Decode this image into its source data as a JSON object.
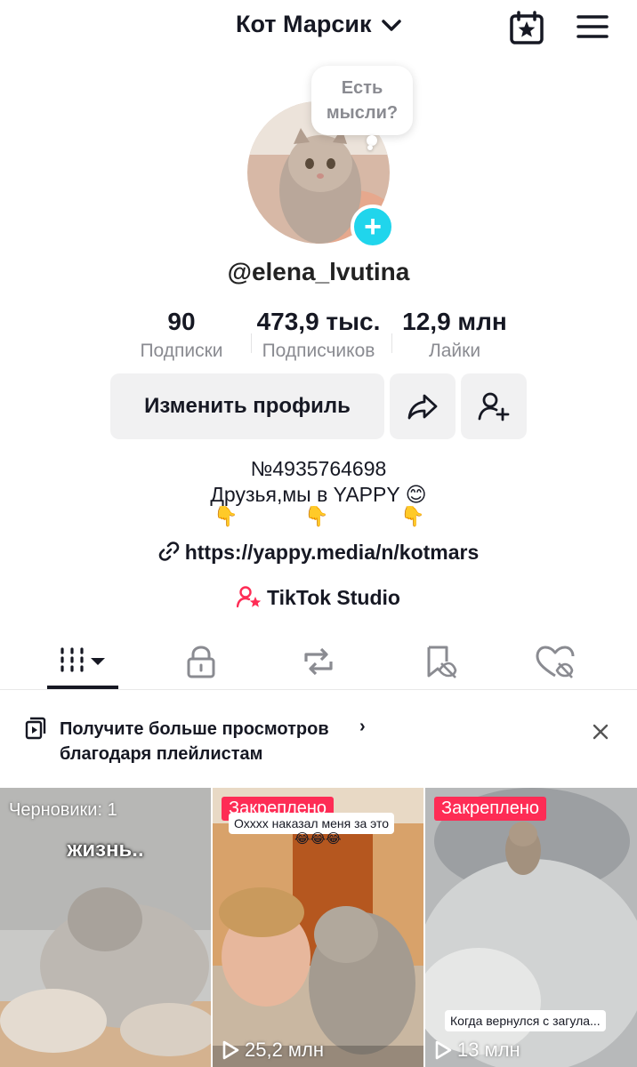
{
  "header": {
    "account_name": "Кот Марсик"
  },
  "profile": {
    "thought_bubble": "Есть мысли?",
    "username": "@elena_lvutina",
    "stats": [
      {
        "value": "90",
        "label": "Подписки"
      },
      {
        "value": "473,9 тыс.",
        "label": "Подписчиков"
      },
      {
        "value": "12,9 млн",
        "label": "Лайки"
      }
    ],
    "edit_button": "Изменить профиль",
    "bio_line1": "№4935764698",
    "bio_line2": "Друзья,мы в YAPPY 😊",
    "pointer_emoji": "👇",
    "link": "https://yappy.media/n/kotmars",
    "studio": "TikTok Studio"
  },
  "promo": {
    "line1": "Получите больше просмотров",
    "line2": "благодаря плейлистам",
    "arrow": "›"
  },
  "videos": [
    {
      "label": "Черновики: 1",
      "overlay": "жизнь.."
    },
    {
      "badge": "Закреплено",
      "caption": "Охххх наказал меня за это",
      "emoji": "😂😂😂",
      "views": "25,2 млн"
    },
    {
      "badge": "Закреплено",
      "caption": "Когда вернулся с загула...",
      "views": "13 млн"
    }
  ],
  "colors": {
    "accent": "#fe2c55",
    "add_badge": "#20d5ec"
  }
}
